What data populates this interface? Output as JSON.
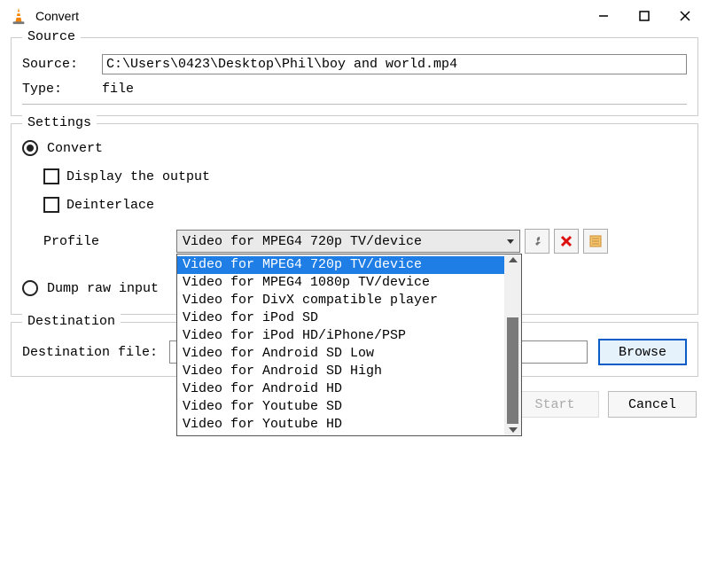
{
  "window": {
    "title": "Convert"
  },
  "source": {
    "legend": "Source",
    "source_label": "Source: ",
    "source_value": "C:\\Users\\0423\\Desktop\\Phil\\boy and world.mp4",
    "type_label": "Type:  ",
    "type_value": "file"
  },
  "settings": {
    "legend": "Settings",
    "convert_label": "Convert",
    "display_output_label": "Display the output",
    "deinterlace_label": "Deinterlace",
    "profile_label": "Profile",
    "profile_selected": "Video for MPEG4 720p TV/device",
    "profile_options": [
      "Video for MPEG4 720p TV/device",
      "Video for MPEG4 1080p TV/device",
      "Video for DivX compatible player",
      "Video for iPod SD",
      "Video for iPod HD/iPhone/PSP",
      "Video for Android SD Low",
      "Video for Android SD High",
      "Video for Android HD",
      "Video for Youtube SD",
      "Video for Youtube HD"
    ],
    "dump_label": "Dump raw input"
  },
  "destination": {
    "legend": "Destination",
    "dest_label": "Destination file:",
    "dest_value": "",
    "browse_label": "Browse"
  },
  "buttons": {
    "start": "Start",
    "cancel": "Cancel"
  }
}
